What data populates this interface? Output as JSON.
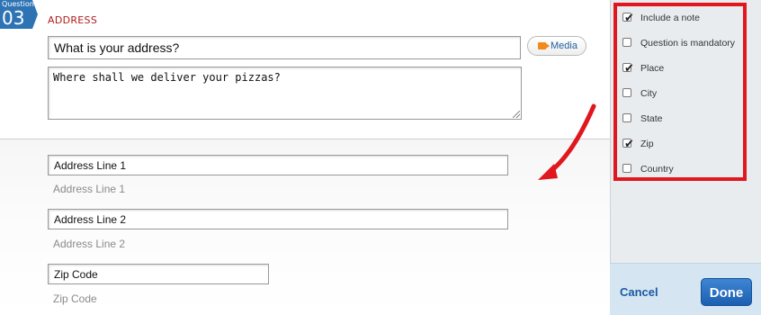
{
  "question": {
    "badge_small": "Question",
    "badge_number": "03",
    "type": "ADDRESS"
  },
  "editor": {
    "title_value": "What is your address?",
    "description_value": "Where shall we deliver your pizzas?",
    "media_label": "Media"
  },
  "preview": {
    "fields": [
      {
        "label": "Address Line 1",
        "hint": "Address Line 1"
      },
      {
        "label": "Address Line 2",
        "hint": "Address Line 2"
      },
      {
        "label": "Zip Code",
        "hint": "Zip Code"
      }
    ]
  },
  "options": [
    {
      "label": "Include a note",
      "checked": true
    },
    {
      "label": "Question is mandatory",
      "checked": false
    },
    {
      "label": "Place",
      "checked": true
    },
    {
      "label": "City",
      "checked": false
    },
    {
      "label": "State",
      "checked": false
    },
    {
      "label": "Zip",
      "checked": true
    },
    {
      "label": "Country",
      "checked": false
    }
  ],
  "footer": {
    "cancel_label": "Cancel",
    "done_label": "Done"
  },
  "colors": {
    "accent": "#2e74b5",
    "highlight": "#e0171e",
    "label_red": "#b01c1c"
  }
}
